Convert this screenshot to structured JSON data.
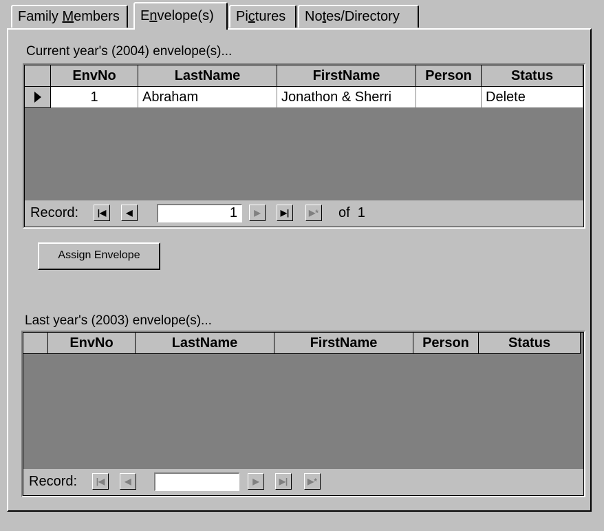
{
  "tabs": [
    {
      "pre": "Family ",
      "accel": "M",
      "post": "embers"
    },
    {
      "pre": "E",
      "accel": "n",
      "post": "velope(s)"
    },
    {
      "pre": "Pi",
      "accel": "c",
      "post": "tures"
    },
    {
      "pre": "No",
      "accel": "t",
      "post": "es/Directory"
    }
  ],
  "current": {
    "caption": "Current year's (2004) envelope(s)...",
    "columns": [
      "EnvNo",
      "LastName",
      "FirstName",
      "Person",
      "Status"
    ],
    "rows": [
      {
        "envno": "1",
        "lastname": "Abraham",
        "firstname": "Jonathon & Sherri",
        "person": "",
        "status": "Delete"
      }
    ],
    "nav": {
      "label": "Record:",
      "record": "1",
      "of": "of  1"
    }
  },
  "assign_button": "Assign Envelope",
  "last": {
    "caption": "Last year's (2003) envelope(s)...",
    "columns": [
      "EnvNo",
      "LastName",
      "FirstName",
      "Person",
      "Status"
    ],
    "nav": {
      "label": "Record:",
      "record": ""
    }
  },
  "icons": {
    "first": "first-record-icon",
    "prev": "previous-record-icon",
    "next": "next-record-icon",
    "last": "last-record-icon",
    "new": "new-record-icon",
    "row_selector": "current-row-pointer-icon"
  }
}
